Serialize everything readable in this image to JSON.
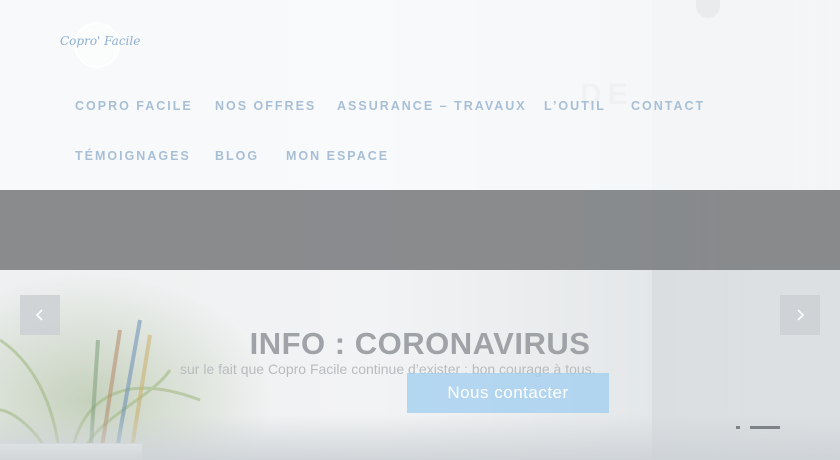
{
  "logo": {
    "text": "Copro' Facile"
  },
  "nav": {
    "items": [
      {
        "label": "COPRO FACILE"
      },
      {
        "label": "NOS OFFRES"
      },
      {
        "label": "ASSURANCE – TRAVAUX"
      },
      {
        "label": "L’OUTIL"
      },
      {
        "label": "CONTACT"
      },
      {
        "label": "TÉMOIGNAGES"
      },
      {
        "label": "BLOG"
      },
      {
        "label": "MON ESPACE"
      }
    ]
  },
  "slider": {
    "title": "INFO : CORONAVIRUS",
    "text": "sur le fait que Copro Facile continue d’exister : bon courage à tous.",
    "cta_label": "Nous contacter",
    "prev_icon": "chevron-left-icon",
    "next_icon": "chevron-right-icon",
    "slide_count": 4,
    "active_slide": 1
  },
  "colors": {
    "nav_text": "#a8bfd6",
    "band": "#808284",
    "cta": "#a0cdf0"
  }
}
